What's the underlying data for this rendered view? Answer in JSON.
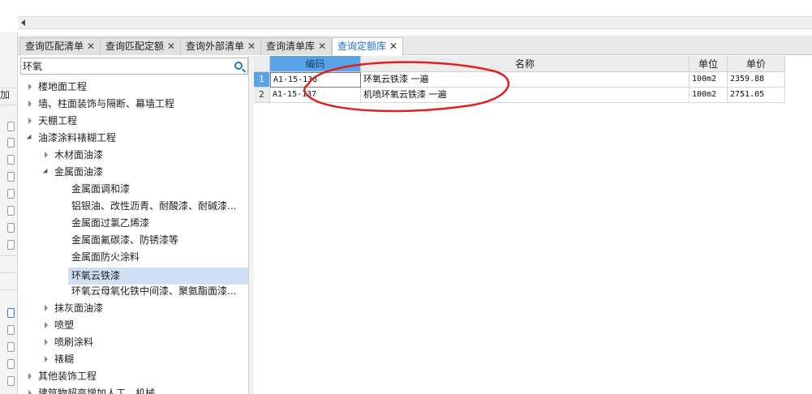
{
  "left_strip": {
    "label": "加"
  },
  "tabs": [
    {
      "label": "查询匹配清单",
      "active": false
    },
    {
      "label": "查询匹配定额",
      "active": false
    },
    {
      "label": "查询外部清单",
      "active": false
    },
    {
      "label": "查询清单库",
      "active": false
    },
    {
      "label": "查询定额库",
      "active": true
    }
  ],
  "search": {
    "value": "环氧"
  },
  "tree": [
    {
      "label": "楼地面工程",
      "level": 0,
      "state": "closed"
    },
    {
      "label": "墙、柱面装饰与隔断、幕墙工程",
      "level": 0,
      "state": "closed"
    },
    {
      "label": "天棚工程",
      "level": 0,
      "state": "closed"
    },
    {
      "label": "油漆涂料裱糊工程",
      "level": 0,
      "state": "open"
    },
    {
      "label": "木材面油漆",
      "level": 1,
      "state": "closed"
    },
    {
      "label": "金属面油漆",
      "level": 1,
      "state": "open"
    },
    {
      "label": "金属面调和漆",
      "level": 2,
      "state": "leaf"
    },
    {
      "label": "铝银油、改性沥青、耐酸漆、耐碱漆...",
      "level": 2,
      "state": "leaf"
    },
    {
      "label": "金属面过氯乙烯漆",
      "level": 2,
      "state": "leaf"
    },
    {
      "label": "金属面氟碳漆、防锈漆等",
      "level": 2,
      "state": "leaf"
    },
    {
      "label": "金属面防火涂料",
      "level": 2,
      "state": "leaf"
    },
    {
      "label": "环氧云铁漆",
      "level": 2,
      "state": "leaf",
      "selected": true
    },
    {
      "label": "环氧云母氧化铁中间漆、聚氨酯面漆...",
      "level": 2,
      "state": "leaf"
    },
    {
      "label": "抹灰面油漆",
      "level": 1,
      "state": "closed"
    },
    {
      "label": "喷塑",
      "level": 1,
      "state": "closed"
    },
    {
      "label": "喷刷涂料",
      "level": 1,
      "state": "closed"
    },
    {
      "label": "裱糊",
      "level": 1,
      "state": "closed"
    },
    {
      "label": "其他装饰工程",
      "level": 0,
      "state": "closed"
    },
    {
      "label": "建筑物超高增加人工、机械",
      "level": 0,
      "state": "closed"
    }
  ],
  "grid": {
    "columns": [
      "编码",
      "名称",
      "单位",
      "单价"
    ],
    "rows": [
      {
        "num": "1",
        "code": "A1-15-136",
        "name": "环氧云铁漆 一遍",
        "unit": "100m2",
        "price": "2359.88"
      },
      {
        "num": "2",
        "code": "A1-15-137",
        "name": "机喷环氧云铁漆 一遍",
        "unit": "100m2",
        "price": "2751.05"
      }
    ]
  },
  "colors": {
    "accent": "#2a6fd1",
    "header_highlight": "#5aa3e8",
    "selection": "#cfe0f5",
    "annotation": "#e02020"
  }
}
